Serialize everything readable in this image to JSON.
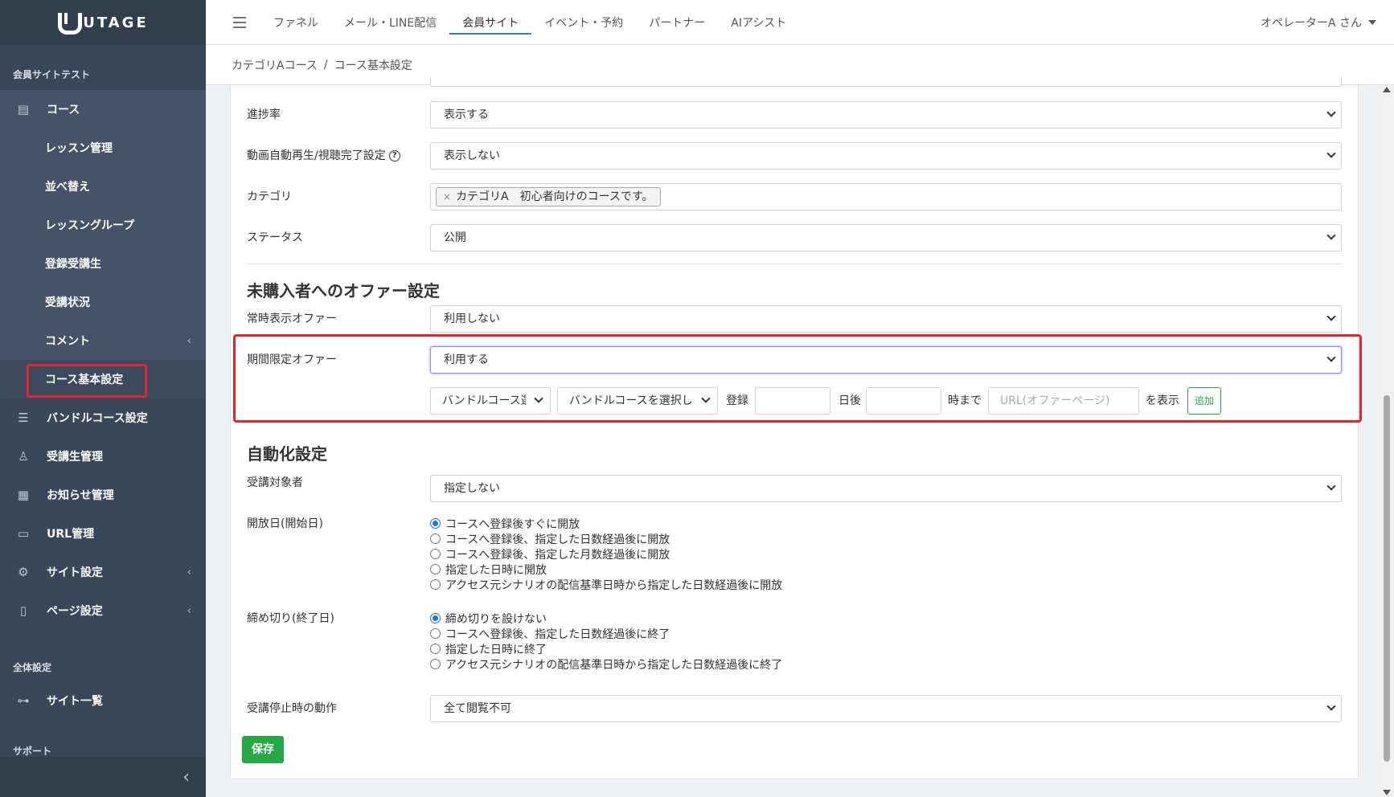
{
  "sidebar": {
    "logo_text": "UTAGE",
    "section_site": "会員サイトテスト",
    "course": "コース",
    "sub_items": [
      "レッスン管理",
      "並べ替え",
      "レッスングループ",
      "登録受講生",
      "受講状況",
      "コメント"
    ],
    "active_item": "コース基本設定",
    "items": [
      "バンドルコース設定",
      "受講生管理",
      "お知らせ管理",
      "URL管理",
      "サイト設定",
      "ページ設定"
    ],
    "section_global": "全体設定",
    "site_list": "サイト一覧",
    "section_support": "サポート"
  },
  "topbar": {
    "tabs": [
      "ファネル",
      "メール・LINE配信",
      "会員サイト",
      "イベント・予約",
      "パートナー",
      "AIアシスト"
    ],
    "active_tab": "会員サイト",
    "user": "オペレーターA さん"
  },
  "breadcrumb": {
    "parent": "カテゴリAコース",
    "separator": "/",
    "current": "コース基本設定"
  },
  "form": {
    "progress_label": "進捗率",
    "progress_value": "表示する",
    "autoplay_label": "動画自動再生/視聴完了設定",
    "autoplay_value": "表示しない",
    "category_label": "カテゴリ",
    "category_tag": "カテゴリA　初心者向けのコースです。",
    "category_tag_remove": "×",
    "status_label": "ステータス",
    "status_value": "公開",
    "offer_section_title": "未購入者へのオファー設定",
    "always_offer_label": "常時表示オファー",
    "always_offer_value": "利用しない",
    "limited_offer_label": "期間限定オファー",
    "limited_offer_value": "利用する",
    "bundle_select_1": "バンドルコース選択",
    "bundle_select_2": "バンドルコースを選択し",
    "text_register": "登録",
    "text_days_after": "日後",
    "text_until": "時まで",
    "url_placeholder": "URL(オファーページ)",
    "text_show": "を表示",
    "add_button": "追加",
    "automation_title": "自動化設定",
    "target_label": "受講対象者",
    "target_value": "指定しない",
    "open_date_label": "開放日(開始日)",
    "open_date_options": [
      "コースへ登録後すぐに開放",
      "コースへ登録後、指定した日数経過後に開放",
      "コースへ登録後、指定した月数経過後に開放",
      "指定した日時に開放",
      "アクセス元シナリオの配信基準日時から指定した日数経過後に開放"
    ],
    "deadline_label": "締め切り(終了日)",
    "deadline_options": [
      "締め切りを設けない",
      "コースへ登録後、指定した日数経過後に終了",
      "指定した日時に終了",
      "アクセス元シナリオの配信基準日時から指定した日数経過後に終了"
    ],
    "stop_label": "受講停止時の動作",
    "stop_value": "全て閲覧不可",
    "save_button": "保存"
  },
  "colors": {
    "sidebar_bg": "#3a4659",
    "highlight": "#e0262e",
    "save_green": "#28a745",
    "tab_underline": "#2f80c8"
  }
}
